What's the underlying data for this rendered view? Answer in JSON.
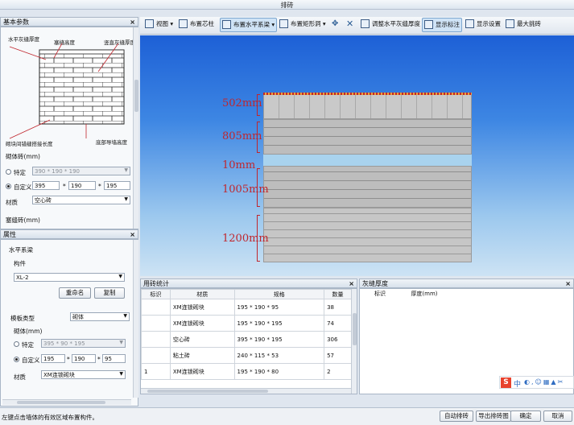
{
  "window_title": "排砖",
  "left_panel": {
    "title": "基本参数",
    "diagram_labels": {
      "horizontal_joint": "水平灰缝厚度",
      "course_height": "塞缝高度",
      "vertical_joint": "竖直灰缝厚度",
      "lap_length": "砌块间错缝搭接长度",
      "bottom_height": "底部导墙高度"
    },
    "brick_section": "砌体砖(mm)",
    "specific_label": "特定",
    "specific_value": "390 * 190 * 190",
    "custom_label": "自定义",
    "custom_l": "395",
    "custom_w": "190",
    "custom_h": "195",
    "material_label": "材质",
    "material_value": "空心砖",
    "plug_section": "塞缝砖(mm)"
  },
  "props_panel": {
    "title": "属性",
    "system_label": "水平系梁",
    "component_label": "构件",
    "component_value": "XL-2",
    "rename_button": "重命名",
    "copy_button": "复制",
    "template_label": "模板类型",
    "template_value": "砌体",
    "brick_label": "砌体(mm)",
    "specific_label": "特定",
    "specific_value": "395 * 90 * 195",
    "custom_label": "自定义",
    "custom_l": "195",
    "custom_w": "190",
    "custom_h": "95",
    "material_label": "材质",
    "material_value": "XM连锁砌块"
  },
  "toolbar": {
    "view": "视图",
    "core_column": "布置芯柱",
    "horizontal_beam": "布置水平系梁",
    "rect_hole": "布置矩形洞",
    "adjust_joint": "调整水平灰缝厚度",
    "show_label": "显示标注",
    "display_settings": "显示设置",
    "max_bricks": "最大挑砖"
  },
  "canvas": {
    "dims": [
      "502mm",
      "805mm",
      "10mm",
      "1005mm",
      "1200mm"
    ]
  },
  "brick_stats": {
    "title": "用砖统计",
    "columns": [
      "标识",
      "材质",
      "规格",
      "数量"
    ],
    "rows": [
      {
        "id": "",
        "material": "XM连锁砌块",
        "spec": "195 * 190 * 95",
        "count": "38"
      },
      {
        "id": "",
        "material": "XM连锁砌块",
        "spec": "195 * 190 * 195",
        "count": "74"
      },
      {
        "id": "",
        "material": "空心砖",
        "spec": "395 * 190 * 195",
        "count": "306"
      },
      {
        "id": "",
        "material": "粘土砖",
        "spec": "240 * 115 * 53",
        "count": "57"
      },
      {
        "id": "1",
        "material": "XM连锁砌块",
        "spec": "195 * 190 * 80",
        "count": "2"
      }
    ]
  },
  "joint_panel": {
    "title": "灰缝厚度",
    "columns": [
      "标识",
      "厚度(mm)"
    ]
  },
  "status": {
    "hint": "左键点击墙体的有效区域布置构件。",
    "auto_button": "自动排砖",
    "export_button": "导出排砖图",
    "ok_button": "确定",
    "cancel_button": "取消"
  },
  "ime": {
    "logo": "S",
    "text": "中"
  }
}
